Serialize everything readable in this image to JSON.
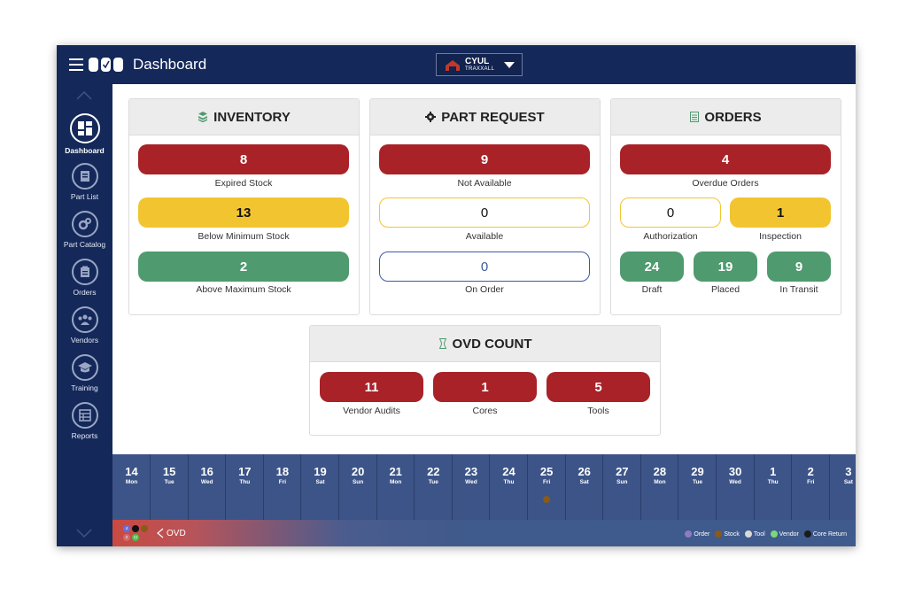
{
  "header": {
    "title": "Dashboard",
    "station_code": "CYUL",
    "station_name": "TRAXXALL"
  },
  "sidebar": {
    "items": [
      {
        "label": "Dashboard",
        "icon": "dashboard-icon",
        "active": true
      },
      {
        "label": "Part List",
        "icon": "part-list-icon"
      },
      {
        "label": "Part Catalog",
        "icon": "part-catalog-icon"
      },
      {
        "label": "Orders",
        "icon": "orders-icon"
      },
      {
        "label": "Vendors",
        "icon": "vendors-icon"
      },
      {
        "label": "Training",
        "icon": "training-icon"
      },
      {
        "label": "Reports",
        "icon": "reports-icon"
      }
    ]
  },
  "inventory": {
    "title": "INVENTORY",
    "expired": {
      "value": "8",
      "label": "Expired Stock"
    },
    "below_min": {
      "value": "13",
      "label": "Below Minimum Stock"
    },
    "above_max": {
      "value": "2",
      "label": "Above Maximum Stock"
    }
  },
  "part_request": {
    "title": "PART REQUEST",
    "not_available": {
      "value": "9",
      "label": "Not Available"
    },
    "available": {
      "value": "0",
      "label": "Available"
    },
    "on_order": {
      "value": "0",
      "label": "On Order"
    }
  },
  "orders": {
    "title": "ORDERS",
    "overdue": {
      "value": "4",
      "label": "Overdue Orders"
    },
    "authorization": {
      "value": "0",
      "label": "Authorization"
    },
    "inspection": {
      "value": "1",
      "label": "Inspection"
    },
    "draft": {
      "value": "24",
      "label": "Draft"
    },
    "placed": {
      "value": "19",
      "label": "Placed"
    },
    "in_transit": {
      "value": "9",
      "label": "In Transit"
    }
  },
  "ovd_count": {
    "title": "OVD COUNT",
    "vendor_audits": {
      "value": "11",
      "label": "Vendor Audits"
    },
    "cores": {
      "value": "1",
      "label": "Cores"
    },
    "tools": {
      "value": "5",
      "label": "Tools"
    }
  },
  "calendar": {
    "days": [
      {
        "num": "14",
        "dow": "Mon"
      },
      {
        "num": "15",
        "dow": "Tue"
      },
      {
        "num": "16",
        "dow": "Wed"
      },
      {
        "num": "17",
        "dow": "Thu"
      },
      {
        "num": "18",
        "dow": "Fri"
      },
      {
        "num": "19",
        "dow": "Sat"
      },
      {
        "num": "20",
        "dow": "Sun"
      },
      {
        "num": "21",
        "dow": "Mon"
      },
      {
        "num": "22",
        "dow": "Tue"
      },
      {
        "num": "23",
        "dow": "Wed"
      },
      {
        "num": "24",
        "dow": "Thu"
      },
      {
        "num": "25",
        "dow": "Fri",
        "event": "stock"
      },
      {
        "num": "26",
        "dow": "Sat"
      },
      {
        "num": "27",
        "dow": "Sun"
      },
      {
        "num": "28",
        "dow": "Mon"
      },
      {
        "num": "29",
        "dow": "Tue"
      },
      {
        "num": "30",
        "dow": "Wed"
      },
      {
        "num": "1",
        "dow": "Thu"
      },
      {
        "num": "2",
        "dow": "Fri"
      },
      {
        "num": "3",
        "dow": "Sat"
      }
    ]
  },
  "bottom": {
    "ovd_label": "OVD",
    "badges": [
      "4",
      "2",
      "11"
    ],
    "legend": [
      {
        "label": "Order",
        "color": "#8e7cc3"
      },
      {
        "label": "Stock",
        "color": "#8a5a18"
      },
      {
        "label": "Tool",
        "color": "#d9d9d9"
      },
      {
        "label": "Vendor",
        "color": "#7ed67a"
      },
      {
        "label": "Core Return",
        "color": "#1b1b1b"
      }
    ]
  },
  "colors": {
    "navy": "#14285a",
    "red": "#a82228",
    "yellow": "#f2c530",
    "green": "#4f9a6f"
  }
}
